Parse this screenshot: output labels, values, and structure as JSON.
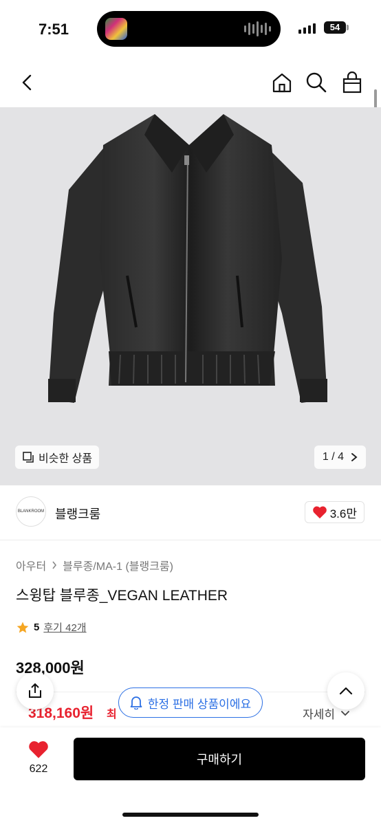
{
  "status_bar": {
    "time": "7:51",
    "battery": "54"
  },
  "nav": {
    "back_icon": "chevron-left-icon",
    "home_icon": "home-icon",
    "search_icon": "search-icon",
    "bag_icon": "shopping-bag-icon"
  },
  "hero": {
    "similar_label": "비슷한 상품",
    "pager": "1 / 4"
  },
  "brand": {
    "logo_text": "BLANKROOM",
    "name": "블랭크룸",
    "likes": "3.6만"
  },
  "breadcrumb": [
    "아우터",
    "블루종/MA-1 (블랭크룸)"
  ],
  "product": {
    "title": "스윙탑 블루종_VEGAN LEATHER",
    "rating": "5",
    "review_label": "후기 42개",
    "price": "328,000원",
    "sale_price": "318,160원",
    "sale_suffix": "최",
    "detail_label": "자세히"
  },
  "floating": {
    "limited_label": "한정 판매 상품이에요"
  },
  "bottom": {
    "like_count": "622",
    "buy_label": "구매하기"
  },
  "colors": {
    "accent_red": "#e8222f",
    "accent_blue": "#2b6fe4",
    "star": "#f5a623"
  }
}
